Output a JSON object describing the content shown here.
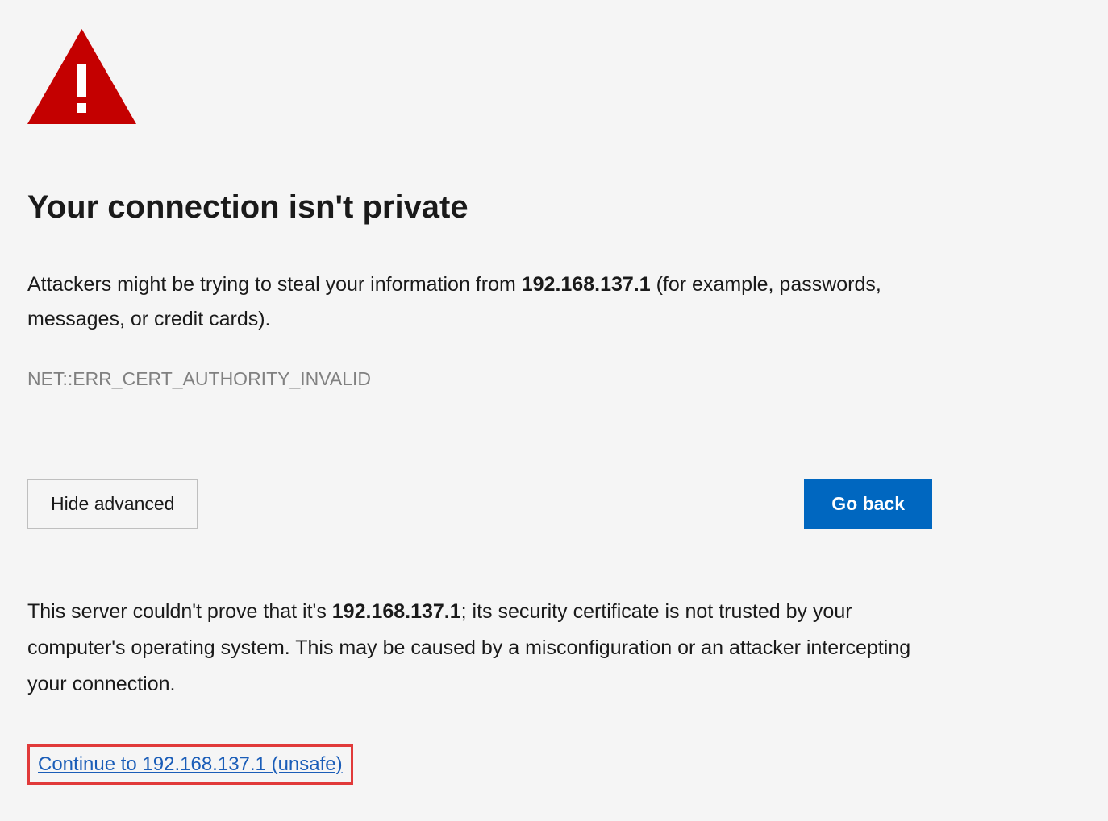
{
  "icon": "warning-triangle-icon",
  "heading": "Your connection isn't private",
  "description": {
    "prefix": "Attackers might be trying to steal your information from ",
    "host": "192.168.137.1",
    "suffix": " (for example, passwords, messages, or credit cards)."
  },
  "error_code": "NET::ERR_CERT_AUTHORITY_INVALID",
  "buttons": {
    "advanced": "Hide advanced",
    "go_back": "Go back"
  },
  "advanced": {
    "prefix": "This server couldn't prove that it's ",
    "host": "192.168.137.1",
    "suffix": "; its security certificate is not trusted by your computer's operating system. This may be caused by a misconfiguration or an attacker intercepting your connection."
  },
  "continue_link": "Continue to 192.168.137.1 (unsafe)"
}
